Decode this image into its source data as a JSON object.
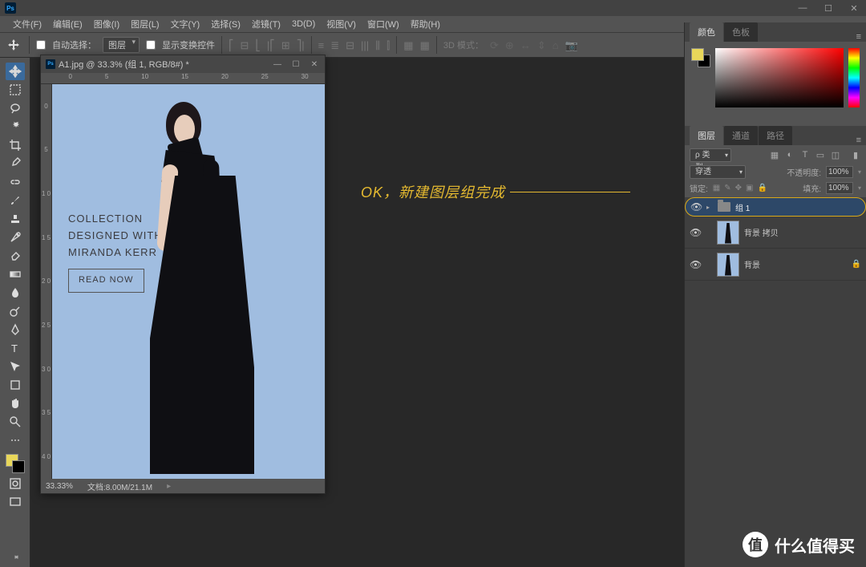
{
  "menu": {
    "items": [
      "文件(F)",
      "编辑(E)",
      "图像(I)",
      "图层(L)",
      "文字(Y)",
      "选择(S)",
      "滤镜(T)",
      "3D(D)",
      "视图(V)",
      "窗口(W)",
      "帮助(H)"
    ]
  },
  "options": {
    "auto_select_label": "自动选择：",
    "auto_select_value": "图层",
    "show_transform_label": "显示变换控件",
    "mode_3d_label": "3D 模式："
  },
  "document": {
    "title": "A1.jpg @ 33.3% (组 1, RGB/8#) *",
    "ruler_h": [
      "0",
      "5",
      "10",
      "15",
      "20",
      "25",
      "30"
    ],
    "ruler_v": [
      "0",
      "5",
      "1\n0",
      "1\n5",
      "2\n0",
      "2\n5",
      "3\n0",
      "3\n5",
      "4\n0"
    ],
    "zoom": "33.33%",
    "docsize": "文档:8.00M/21.1M",
    "text": {
      "line1": "COLLECTION",
      "line2": "DESIGNED WITH",
      "line3": "MIRANDA KERR",
      "btn": "READ NOW"
    }
  },
  "panels": {
    "color_tab": "颜色",
    "swatches_tab": "色板",
    "layers_tab": "图层",
    "channels_tab": "通道",
    "paths_tab": "路径"
  },
  "layers": {
    "kind_label": "类型",
    "blend_mode": "穿透",
    "opacity_label": "不透明度:",
    "opacity_value": "100%",
    "lock_label": "锁定:",
    "fill_label": "填充:",
    "fill_value": "100%",
    "items": [
      {
        "name": "组 1",
        "type": "folder",
        "selected": true
      },
      {
        "name": "背景 拷贝",
        "type": "image"
      },
      {
        "name": "背景",
        "type": "image",
        "locked": true
      }
    ]
  },
  "annotation": "OK，新建图层组完成",
  "watermark": "什么值得买"
}
